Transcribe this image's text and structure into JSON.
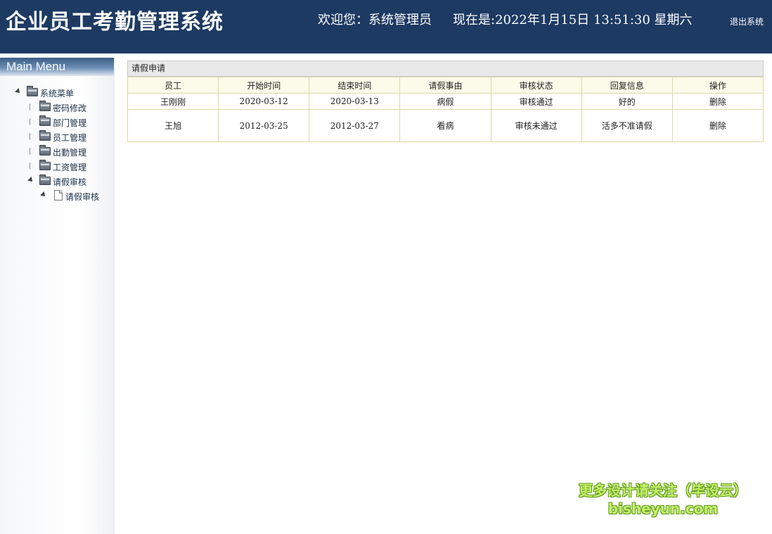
{
  "header": {
    "title": "企业员工考勤管理系统",
    "welcome": "欢迎您：系统管理员",
    "datetime": "现在是:2022年1月15日 13:51:30 星期六",
    "logout_label": "退出系统",
    "background_color": "#1d3a63"
  },
  "sidebar": {
    "menu_title": "Main Menu",
    "tree": {
      "root": {
        "label": "系统菜单",
        "expanded": true,
        "icon": "folder-icon"
      },
      "items": [
        {
          "label": "密码修改",
          "expanded": false,
          "icon": "folder-icon"
        },
        {
          "label": "部门管理",
          "expanded": false,
          "icon": "folder-icon"
        },
        {
          "label": "员工管理",
          "expanded": false,
          "icon": "folder-icon"
        },
        {
          "label": "出勤管理",
          "expanded": false,
          "icon": "folder-icon"
        },
        {
          "label": "工资管理",
          "expanded": false,
          "icon": "folder-icon"
        },
        {
          "label": "请假审核",
          "expanded": true,
          "icon": "folder-icon"
        }
      ],
      "leaf": {
        "label": "请假审核",
        "icon": "file-icon"
      }
    }
  },
  "main": {
    "panel_title": "请假申请",
    "table": {
      "headers": [
        "员工",
        "开始时间",
        "结束时间",
        "请假事由",
        "审核状态",
        "回复信息",
        "操作"
      ],
      "rows": [
        {
          "employee": "王刚刚",
          "start": "2020-03-12",
          "end": "2020-03-13",
          "reason": "病假",
          "status": "审核通过",
          "reply": "好的",
          "action": "删除"
        },
        {
          "employee": "王旭",
          "start": "2012-03-25",
          "end": "2012-03-27",
          "reason": "看病",
          "status": "审核未通过",
          "reply": "活多不准请假",
          "action": "删除"
        }
      ],
      "header_bg": "#fbfbea",
      "border_color": "#d9d9a8"
    }
  },
  "watermark": {
    "line1": "更多设计请关注（毕设云）",
    "line2": "bisheyun.com"
  }
}
